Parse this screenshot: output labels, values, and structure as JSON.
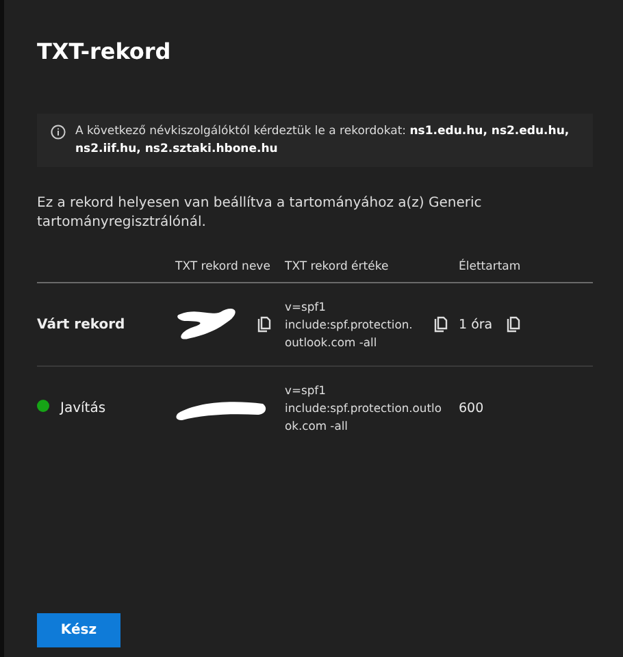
{
  "dialog": {
    "title": "TXT-rekord"
  },
  "info": {
    "text": "A következő névkiszolgálóktól kérdeztük le a rekordokat: **ns1.edu.hu, ns2.edu.hu, ns2.iif.hu, ns2.sztaki.hbone.hu**"
  },
  "message": "Ez a rekord helyesen van beállítva a tartományához a(z) Generic tartományregisztrálónál.",
  "table": {
    "columns": [
      "TXT rekord neve",
      "TXT rekord értéke",
      "Élettartam"
    ],
    "rows": [
      {
        "label": "Várt rekord",
        "kind": "expected",
        "name_redacted": true,
        "value": [
          "v=spf1",
          "include:spf.protection.",
          "outlook.com -all"
        ],
        "ttl": "1 óra",
        "copyable": true
      },
      {
        "label": "Javítás",
        "kind": "status",
        "color": "#16a416",
        "name_redacted": true,
        "value": [
          "v=spf1",
          "include:spf.protection.outlo",
          "ok.com -all"
        ],
        "ttl": "600",
        "copyable": false
      }
    ]
  },
  "buttons": [
    {
      "label": "Kész"
    }
  ]
}
